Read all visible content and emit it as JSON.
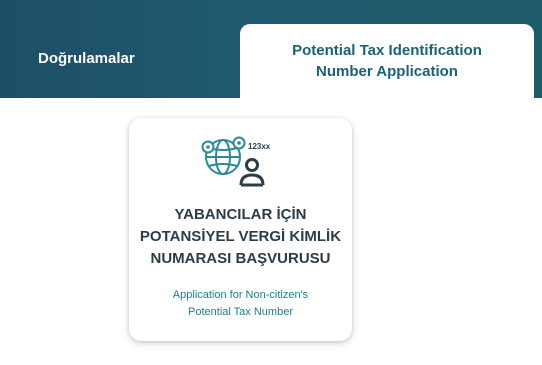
{
  "tabs": {
    "verifications_label": "Doğrulamalar",
    "active_label": "Potential Tax Identification Number Application"
  },
  "card": {
    "icon_name": "globe-person-number-icon",
    "icon_badge_text": "123xx",
    "title_lines": [
      "YABANCILAR İÇİN",
      "POTANSİYEL VERGİ KİMLİK",
      "NUMARASI BAŞVURUSU"
    ],
    "subtitle_lines": [
      "Application for Non-citizen's",
      "Potential Tax Number"
    ]
  },
  "colors": {
    "header_bg": "#1d5068",
    "active_tab_text": "#1a6279",
    "card_title": "#2c3d4a",
    "card_subtitle": "#1f7e91",
    "icon_teal": "#2b8a9a",
    "icon_dark": "#2c3d4a"
  }
}
